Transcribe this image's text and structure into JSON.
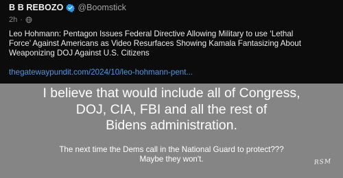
{
  "post": {
    "author_name": "B B REBOZO",
    "verified_icon": "verified-badge-icon",
    "author_handle": "@Boomstick",
    "timestamp": "2h",
    "meta_separator": "·",
    "audience_icon": "globe-icon",
    "text": "Leo Hohmann: Pentagon Issues Federal Directive Allowing Military to use ‘Lethal\nForce’ Against Americans as Video Resurfaces Showing Kamala Fantasizing About\nWeaponizing DOJ Against U.S. Citizens",
    "link": "thegatewaypundit.com/2024/10/leo-hohmann-pent...",
    "link_color": "#4f97e8"
  },
  "meme": {
    "main_text": "I believe that would include all of Congress,\nDOJ, CIA, FBI and all the rest of\nBidens administration.",
    "sub_text": "The next time the Dems call in the National Guard to protect???\nMaybe they won't.",
    "signature": "RSM"
  },
  "colors": {
    "post_background": "#0c0c0c",
    "meme_background": "#858585",
    "verified": "#1d9bf0"
  }
}
